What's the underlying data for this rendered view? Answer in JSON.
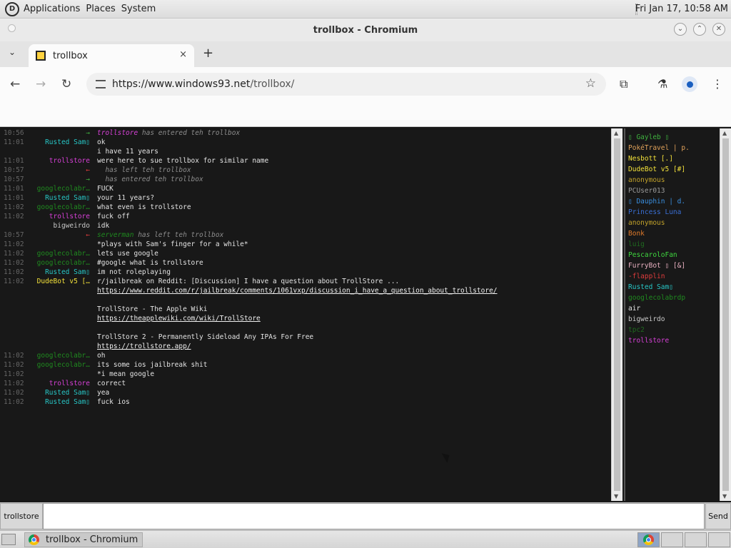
{
  "panel": {
    "applications": "Applications",
    "places": "Places",
    "system": "System",
    "clock": "Fri Jan 17, 10:58 AM"
  },
  "window": {
    "title": "trollbox - Chromium"
  },
  "tab": {
    "title": "trollbox",
    "close": "×",
    "new_tab": "+"
  },
  "toolbar": {
    "url_host": "https://www.windows93.net",
    "url_path": "/trollbox/"
  },
  "chat": {
    "messages": [
      {
        "time": "10:56",
        "nick": "→",
        "nick_color": "#3fb23f",
        "text": "trollstore has entered teh trollbox",
        "style": "sys",
        "sys_name": "trollstore",
        "sys_color": "#d640d6",
        "sys_rest": " has entered teh trollbox"
      },
      {
        "time": "11:01",
        "nick": "Rusted Sam▯",
        "nick_color": "#27c6c6",
        "text": "ok"
      },
      {
        "time": "",
        "nick": "",
        "nick_color": "#fff",
        "text": "i have 11 years"
      },
      {
        "time": "11:01",
        "nick": "trollstore",
        "nick_color": "#d640d6",
        "text": "were here to sue trollbox for similar name"
      },
      {
        "time": "10:57",
        "nick": "←",
        "nick_color": "#e03c3c",
        "text": "  has left teh trollbox",
        "style": "sys",
        "sys_name": "",
        "sys_color": "#8d8d8d",
        "sys_rest": "  has left teh trollbox"
      },
      {
        "time": "10:57",
        "nick": "→",
        "nick_color": "#3fb23f",
        "text": "  has entered teh trollbox",
        "style": "sys",
        "sys_name": "",
        "sys_color": "#8d8d8d",
        "sys_rest": "  has entered teh trollbox"
      },
      {
        "time": "11:01",
        "nick": "googlecolabr…",
        "nick_color": "#1f8a1f",
        "text": "FUCK"
      },
      {
        "time": "11:01",
        "nick": "Rusted Sam▯",
        "nick_color": "#27c6c6",
        "text": "your 11 years?"
      },
      {
        "time": "11:02",
        "nick": "googlecolabr…",
        "nick_color": "#1f8a1f",
        "text": "what even is trollstore"
      },
      {
        "time": "11:02",
        "nick": "trollstore",
        "nick_color": "#d640d6",
        "text": "fuck off"
      },
      {
        "time": "",
        "nick": "bigweirdo",
        "nick_color": "#c8c8c8",
        "text": "idk"
      },
      {
        "time": "10:57",
        "nick": "←",
        "nick_color": "#e03c3c",
        "text": "serverman has left teh trollbox",
        "style": "sys",
        "sys_name": "serverman",
        "sys_color": "#1f8a1f",
        "sys_rest": " has left teh trollbox"
      },
      {
        "time": "11:02",
        "nick": "",
        "nick_color": "#fff",
        "text": "*plays with Sam's finger for a while*"
      },
      {
        "time": "11:02",
        "nick": "googlecolabr…",
        "nick_color": "#1f8a1f",
        "text": "lets use google"
      },
      {
        "time": "11:02",
        "nick": "googlecolabr…",
        "nick_color": "#1f8a1f",
        "text": "#google what is trollstore"
      },
      {
        "time": "11:02",
        "nick": "Rusted Sam▯",
        "nick_color": "#27c6c6",
        "text": "im not roleplaying"
      },
      {
        "time": "11:02",
        "nick": "DudeBot v5 […",
        "nick_color": "#f2e03a",
        "text": "r/jailbreak on Reddit: [Discussion] I have a question about TrollStore ..."
      },
      {
        "time": "",
        "nick": "",
        "nick_color": "#fff",
        "text": "https://www.reddit.com/r/jailbreak/comments/1061vxp/discussion_i_have_a_question_about_trollstore/",
        "style": "link"
      },
      {
        "time": "",
        "nick": "",
        "nick_color": "#fff",
        "text": ""
      },
      {
        "time": "",
        "nick": "",
        "nick_color": "#fff",
        "text": "TrollStore - The Apple Wiki"
      },
      {
        "time": "",
        "nick": "",
        "nick_color": "#fff",
        "text": "https://theapplewiki.com/wiki/TrollStore",
        "style": "link"
      },
      {
        "time": "",
        "nick": "",
        "nick_color": "#fff",
        "text": ""
      },
      {
        "time": "",
        "nick": "",
        "nick_color": "#fff",
        "text": "TrollStore 2 - Permanently Sideload Any IPAs For Free"
      },
      {
        "time": "",
        "nick": "",
        "nick_color": "#fff",
        "text": "https://trollstore.app/",
        "style": "link"
      },
      {
        "time": "11:02",
        "nick": "googlecolabr…",
        "nick_color": "#1f8a1f",
        "text": "oh"
      },
      {
        "time": "11:02",
        "nick": "googlecolabr…",
        "nick_color": "#1f8a1f",
        "text": "its some ios jailbreak shit"
      },
      {
        "time": "11:02",
        "nick": "",
        "nick_color": "#fff",
        "text": "*i mean google"
      },
      {
        "time": "11:02",
        "nick": "trollstore",
        "nick_color": "#d640d6",
        "text": "correct"
      },
      {
        "time": "11:02",
        "nick": "Rusted Sam▯",
        "nick_color": "#27c6c6",
        "text": "yea"
      },
      {
        "time": "11:02",
        "nick": "Rusted Sam▯",
        "nick_color": "#27c6c6",
        "text": "fuck ios"
      }
    ]
  },
  "users": [
    {
      "name": "▯ Gayleb ▯",
      "color": "#3fb23f"
    },
    {
      "name": "PokéTravel | p.",
      "color": "#e0a15a"
    },
    {
      "name": "Nesbott [.]",
      "color": "#f2e03a"
    },
    {
      "name": "DudeBot v5 [#]",
      "color": "#f2e03a"
    },
    {
      "name": "anonymous",
      "color": "#c2a22a"
    },
    {
      "name": "PCUser013",
      "color": "#9a9a9a"
    },
    {
      "name": "▯ Dauphin | d.",
      "color": "#3a8fe0"
    },
    {
      "name": "Princess Luna",
      "color": "#3a6fd6"
    },
    {
      "name": "anonymous",
      "color": "#c2a22a"
    },
    {
      "name": "Bonk",
      "color": "#e07a2a"
    },
    {
      "name": "luig",
      "color": "#1f6a1f"
    },
    {
      "name": "PescaroloFan",
      "color": "#3fd63f"
    },
    {
      "name": "FurryBot ▯ [&]",
      "color": "#e8b0c0"
    },
    {
      "name": "-flapplin",
      "color": "#e03c3c"
    },
    {
      "name": "Rusted Sam▯",
      "color": "#27c6c6"
    },
    {
      "name": "googlecolabrdp",
      "color": "#1f8a1f"
    },
    {
      "name": "air",
      "color": "#e4e4e4"
    },
    {
      "name": "bigweirdo",
      "color": "#c8c8c8"
    },
    {
      "name": "tpc2",
      "color": "#1f6a1f"
    },
    {
      "name": "trollstore",
      "color": "#d640d6"
    }
  ],
  "input": {
    "nick_label": "trollstore",
    "value": "",
    "send_label": "Send"
  },
  "taskbar": {
    "task_label": "trollbox - Chromium"
  }
}
